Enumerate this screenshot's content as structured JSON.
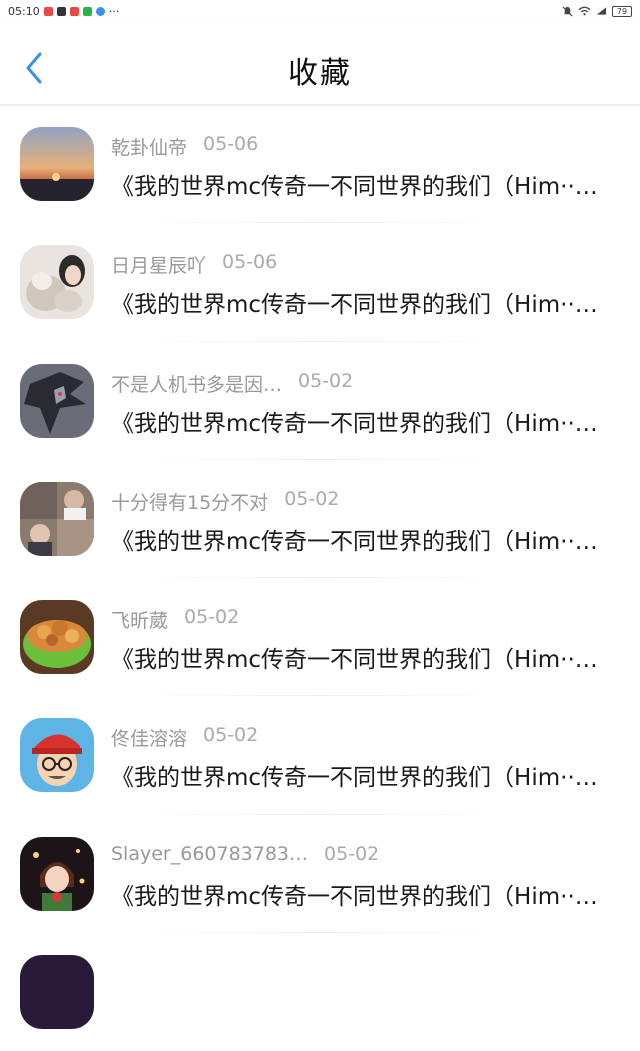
{
  "status": {
    "time": "05:10",
    "dots": "···",
    "battery": "79"
  },
  "header": {
    "title": "收藏"
  },
  "items": [
    {
      "name": "乾卦仙帝",
      "date": "05-06",
      "text": "《我的世界mc传奇一不同世界的我们（Him··…",
      "avatar": "sunset-avatar"
    },
    {
      "name": "日月星辰吖",
      "date": "05-06",
      "text": "《我的世界mc传奇一不同世界的我们（Him··…",
      "avatar": "cats-avatar"
    },
    {
      "name": "不是人机书多是因…",
      "date": "05-02",
      "text": "《我的世界mc传奇一不同世界的我们（Him··…",
      "avatar": "dragon-avatar"
    },
    {
      "name": "十分得有15分不对",
      "date": "05-02",
      "text": "《我的世界mc传奇一不同世界的我们（Him··…",
      "avatar": "people-avatar"
    },
    {
      "name": "飞昕葳",
      "date": "05-02",
      "text": "《我的世界mc传奇一不同世界的我们（Him··…",
      "avatar": "food-avatar"
    },
    {
      "name": "佟佳溶溶",
      "date": "05-02",
      "text": "《我的世界mc传奇一不同世界的我们（Him··…",
      "avatar": "cartoon-avatar"
    },
    {
      "name": "Slayer_660783783…",
      "date": "05-02",
      "text": "《我的世界mc传奇一不同世界的我们（Him··…",
      "avatar": "anime-avatar"
    }
  ]
}
